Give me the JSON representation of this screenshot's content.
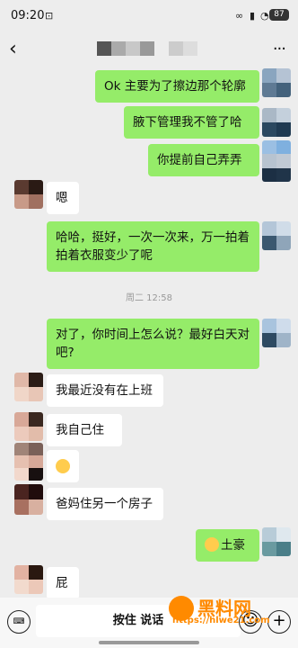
{
  "status": {
    "time": "09:20",
    "battery": "87"
  },
  "nav": {
    "back_icon": "back-arrow-icon",
    "more_icon": "more-icon"
  },
  "messages": [
    {
      "side": "me",
      "text": "Ok 主要为了擦边那个轮廓"
    },
    {
      "side": "me",
      "text": "腋下管理我不管了哈"
    },
    {
      "side": "me",
      "text": "你提前自己弄弄"
    },
    {
      "side": "them",
      "text": "嗯"
    },
    {
      "side": "me",
      "text": "哈哈，挺好，一次一次来，万一拍着拍着衣服变少了呢"
    },
    {
      "side": "time",
      "text": "周二 12:58"
    },
    {
      "side": "me",
      "text": "对了，你时间上怎么说？最好白天对吧?"
    },
    {
      "side": "them",
      "text": "我最近没有在上班"
    },
    {
      "side": "them",
      "text": "我自己住"
    },
    {
      "side": "them",
      "text": ""
    },
    {
      "side": "them",
      "text": "爸妈住另一个房子"
    },
    {
      "side": "me",
      "text": "土豪"
    },
    {
      "side": "them",
      "text": "屁"
    }
  ],
  "input": {
    "hold_to_talk": "按住 说话"
  },
  "watermark": {
    "text": "黑料网",
    "url": "https://hlwe21.com"
  }
}
